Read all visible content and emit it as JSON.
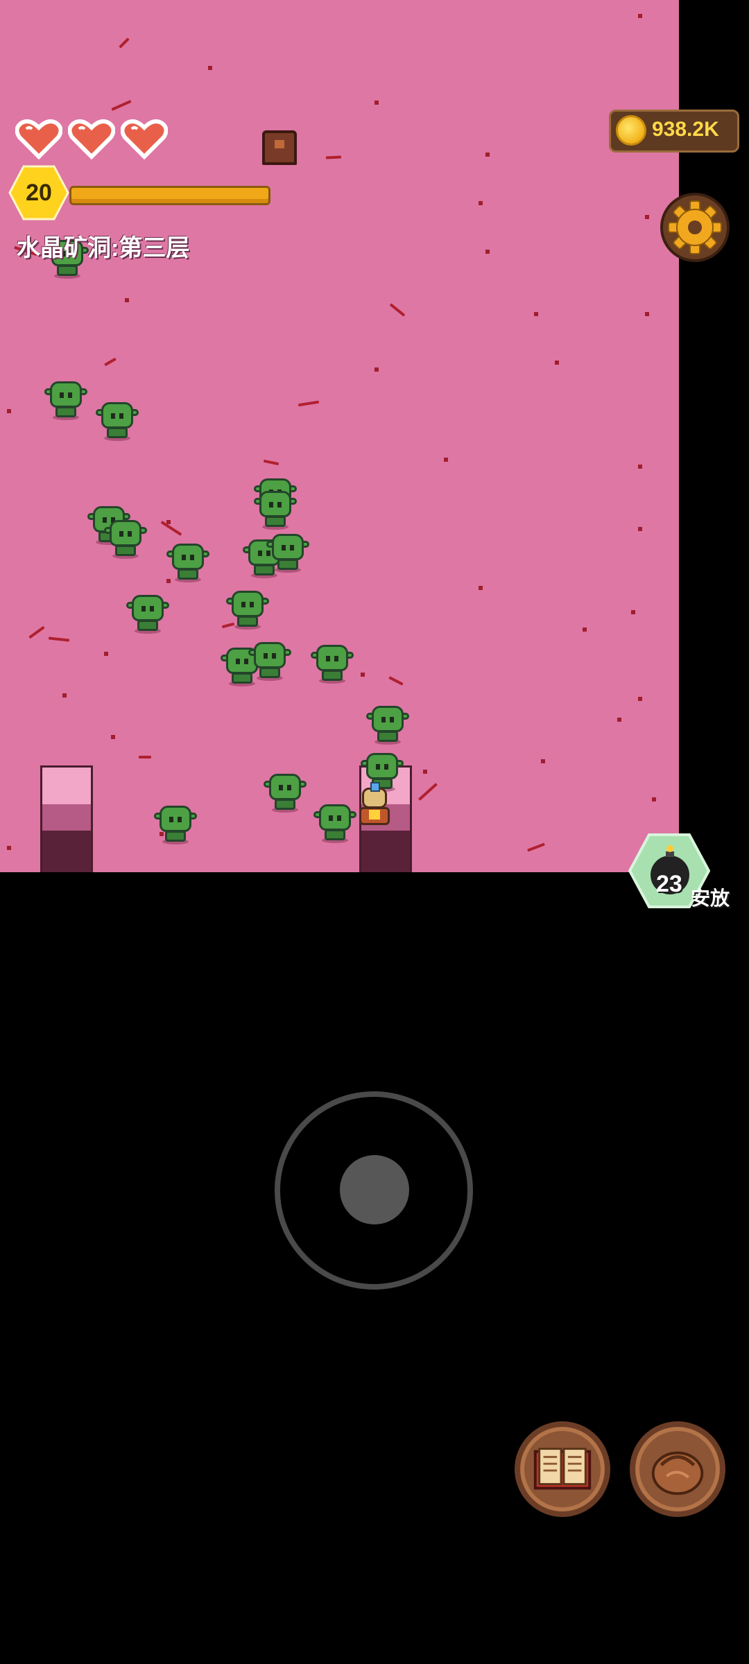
{
  "hud": {
    "hearts": 3,
    "level": "20",
    "floor_name": "水晶矿洞:第三层",
    "coins": "938.2K"
  },
  "bomb": {
    "count": "23",
    "label": "安放"
  },
  "colors": {
    "ground": "#de77a4",
    "goblin": "#4da043",
    "xp_bar": "#f0a818",
    "coin_gold": "#ffd84a"
  },
  "icons": [
    "heart-icon",
    "coin-icon",
    "gear-icon",
    "bomb-icon",
    "book-icon",
    "bag-icon"
  ]
}
